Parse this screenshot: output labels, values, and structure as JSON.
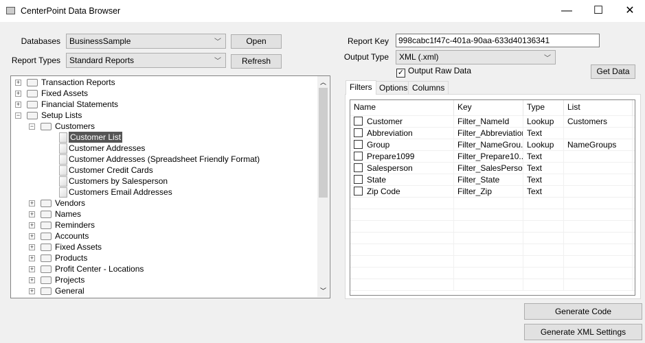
{
  "window": {
    "title": "CenterPoint Data Browser",
    "minimize": "—",
    "maximize": "☐",
    "close": "✕"
  },
  "left": {
    "databases_label": "Databases",
    "databases_value": "BusinessSample",
    "report_types_label": "Report Types",
    "report_types_value": "Standard Reports",
    "open": "Open",
    "refresh": "Refresh"
  },
  "tree": [
    {
      "label": "Transaction Reports",
      "level": 0,
      "type": "folder",
      "state": "+"
    },
    {
      "label": "Fixed Assets",
      "level": 0,
      "type": "folder",
      "state": "+"
    },
    {
      "label": "Financial Statements",
      "level": 0,
      "type": "folder",
      "state": "+"
    },
    {
      "label": "Setup Lists",
      "level": 0,
      "type": "folder",
      "state": "-"
    },
    {
      "label": "Customers",
      "level": 1,
      "type": "folder",
      "state": "-"
    },
    {
      "label": "Customer List",
      "level": 2,
      "type": "doc",
      "selected": true
    },
    {
      "label": "Customer Addresses",
      "level": 2,
      "type": "doc"
    },
    {
      "label": "Customer Addresses (Spreadsheet Friendly Format)",
      "level": 2,
      "type": "doc"
    },
    {
      "label": "Customer Credit Cards",
      "level": 2,
      "type": "doc"
    },
    {
      "label": "Customers by Salesperson",
      "level": 2,
      "type": "doc"
    },
    {
      "label": "Customers Email Addresses",
      "level": 2,
      "type": "doc"
    },
    {
      "label": "Vendors",
      "level": 1,
      "type": "folder",
      "state": "+"
    },
    {
      "label": "Names",
      "level": 1,
      "type": "folder",
      "state": "+"
    },
    {
      "label": "Reminders",
      "level": 1,
      "type": "folder",
      "state": "+"
    },
    {
      "label": "Accounts",
      "level": 1,
      "type": "folder",
      "state": "+"
    },
    {
      "label": "Fixed Assets",
      "level": 1,
      "type": "folder",
      "state": "+"
    },
    {
      "label": "Products",
      "level": 1,
      "type": "folder",
      "state": "+"
    },
    {
      "label": "Profit Center - Locations",
      "level": 1,
      "type": "folder",
      "state": "+"
    },
    {
      "label": "Projects",
      "level": 1,
      "type": "folder",
      "state": "+"
    },
    {
      "label": "General",
      "level": 1,
      "type": "folder",
      "state": "+"
    }
  ],
  "right": {
    "report_key_label": "Report Key",
    "report_key_value": "998cabc1f47c-401a-90aa-633d40136341",
    "output_type_label": "Output Type",
    "output_type_value": "XML (.xml)",
    "raw_label": "Output Raw Data",
    "raw_checked": true,
    "get_data": "Get Data"
  },
  "tabs": [
    "Filters",
    "Options",
    "Columns"
  ],
  "grid": {
    "headers": [
      "Name",
      "Key",
      "Type",
      "List"
    ],
    "rows": [
      [
        "Customer",
        "Filter_NameId",
        "Lookup",
        "Customers"
      ],
      [
        "Abbreviation",
        "Filter_Abbreviation",
        "Text",
        ""
      ],
      [
        "Group",
        "Filter_NameGrou...",
        "Lookup",
        "NameGroups"
      ],
      [
        "Prepare1099",
        "Filter_Prepare10...",
        "Text",
        ""
      ],
      [
        "Salesperson",
        "Filter_SalesPerson",
        "Text",
        ""
      ],
      [
        "State",
        "Filter_State",
        "Text",
        ""
      ],
      [
        "Zip Code",
        "Filter_Zip",
        "Text",
        ""
      ]
    ]
  },
  "actions": {
    "generate_code": "Generate Code",
    "generate_xml": "Generate XML Settings"
  }
}
